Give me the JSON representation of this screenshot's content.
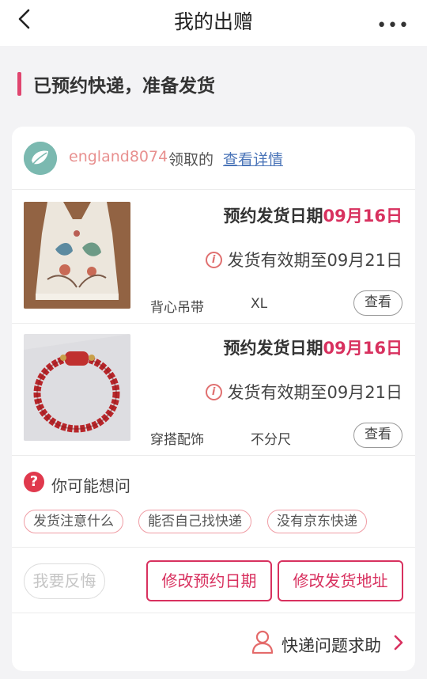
{
  "nav": {
    "title": "我的出赠",
    "more": "•••"
  },
  "status": {
    "text": "已预约快递，准备发货"
  },
  "user": {
    "name": "england8074",
    "action": "领取的",
    "link": "查看详情"
  },
  "items": [
    {
      "date_label": "预约发货日期",
      "date": "09月16日",
      "valid_text": "发货有效期至09月21日",
      "category": "背心吊带",
      "size": "XL",
      "view_label": "查看"
    },
    {
      "date_label": "预约发货日期",
      "date": "09月16日",
      "valid_text": "发货有效期至09月21日",
      "category": "穿搭配饰",
      "size": "不分尺",
      "view_label": "查看"
    }
  ],
  "faq": {
    "icon": "?",
    "title": "你可能想问",
    "chips": [
      "发货注意什么",
      "能否自己找快递",
      "没有京东快递"
    ]
  },
  "actions": {
    "regret": "我要反悔",
    "change_date": "修改预约日期",
    "change_address": "修改发货地址"
  },
  "help": {
    "text": "快递问题求助"
  },
  "colors": {
    "accent": "#d8315f",
    "link": "#4a74b8",
    "username": "#e8908f"
  }
}
